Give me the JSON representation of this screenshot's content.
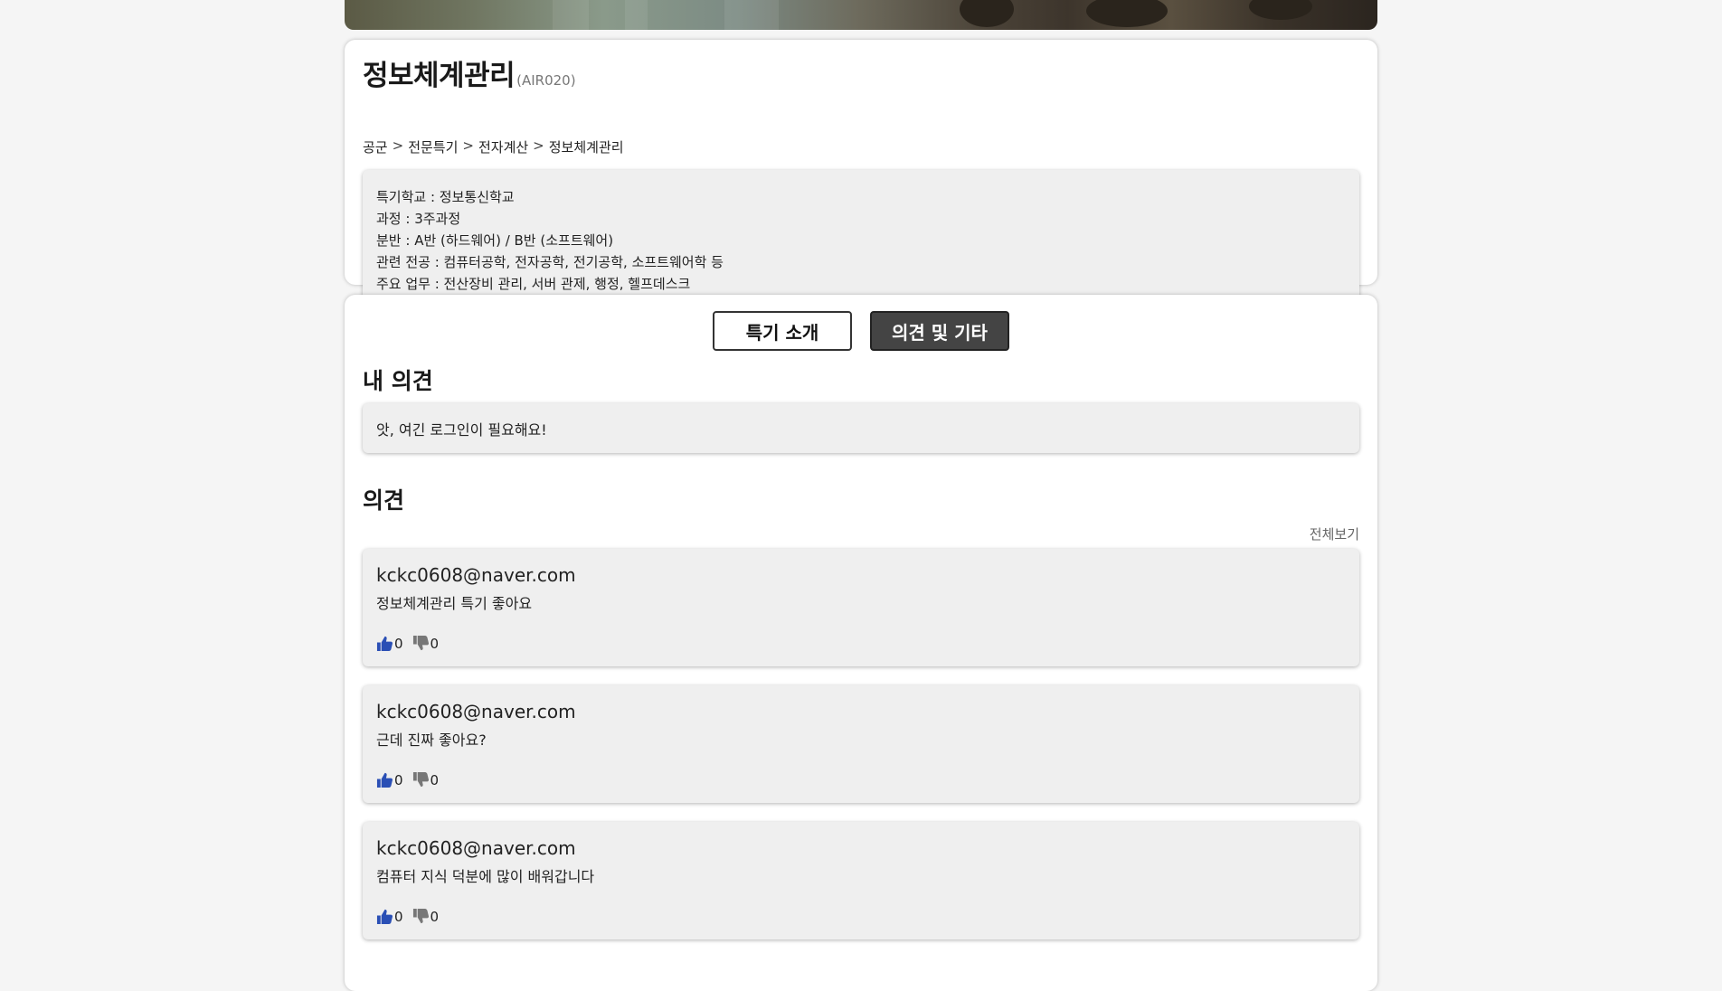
{
  "specialty": {
    "title": "정보체계관리",
    "code": "(AIR020)",
    "breadcrumb": [
      "공군",
      "전문특기",
      "전자계산",
      "정보체계관리"
    ],
    "breadcrumb_separator": ">",
    "info": [
      "특기학교 : 정보통신학교",
      "과정 : 3주과정",
      "분반 : A반 (하드웨어) / B반 (소프트웨어)",
      "관련 전공 : 컴퓨터공학, 전자공학, 전기공학, 소프트웨어학 등",
      "주요 업무 : 전산장비 관리, 서버 관제, 행정, 헬프데스크"
    ]
  },
  "tabs": {
    "intro": "특기 소개",
    "opinions": "의견 및 기타"
  },
  "my_opinion": {
    "title": "내 의견",
    "login_message": "앗, 여긴 로그인이 필요해요!"
  },
  "opinions": {
    "title": "의견",
    "view_all": "전체보기",
    "items": [
      {
        "author": "kckc0608@naver.com",
        "text": "정보체계관리 특기 좋아요",
        "likes": "0",
        "dislikes": "0"
      },
      {
        "author": "kckc0608@naver.com",
        "text": "근데 진짜 좋아요?",
        "likes": "0",
        "dislikes": "0"
      },
      {
        "author": "kckc0608@naver.com",
        "text": "컴퓨터 지식 덕분에 많이 배워갑니다",
        "likes": "0",
        "dislikes": "0"
      }
    ]
  },
  "colors": {
    "like_icon": "#2a4fb5",
    "dislike_icon": "#777777",
    "active_tab": "#444444"
  },
  "icons": {
    "like": "thumbs-up-icon",
    "dislike": "thumbs-down-icon"
  }
}
